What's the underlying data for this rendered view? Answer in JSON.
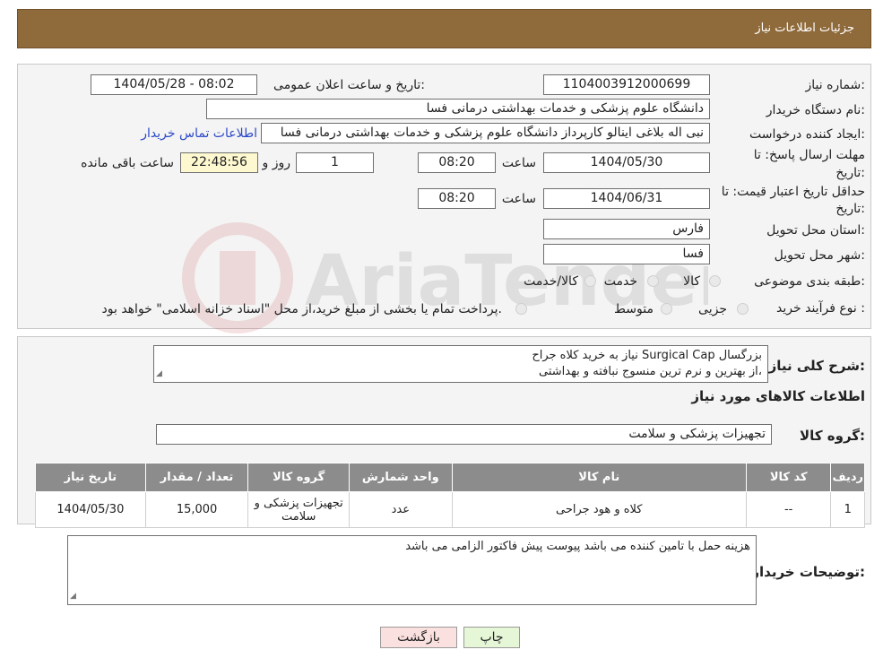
{
  "header": {
    "title": "جزئیات اطلاعات نیاز"
  },
  "need_number": {
    "label": "شماره نیاز:",
    "value": "1104003912000699"
  },
  "announce_datetime": {
    "label": "تاریخ و ساعت اعلان عمومی:",
    "value": "1404/05/28 - 08:02"
  },
  "buyer_org": {
    "label": "نام دستگاه خریدار:",
    "value": "دانشگاه علوم پزشکی و خدمات بهداشتی درمانی فسا"
  },
  "requester": {
    "label": "ایجاد کننده درخواست:",
    "value": "نبی اله بلاغی اینالو کارپرداز دانشگاه علوم پزشکی و خدمات بهداشتی درمانی فسا",
    "contact_link": "اطلاعات تماس خریدار"
  },
  "reply_deadline": {
    "label_line1": "مهلت ارسال پاسخ: تا",
    "label_line2": "تاریخ:",
    "date": "1404/05/30",
    "time_label": "ساعت",
    "time": "08:20",
    "days": "1",
    "days_label": "روز و",
    "remaining": "22:48:56",
    "remaining_label": "ساعت باقی مانده"
  },
  "price_validity": {
    "label_line1": "حداقل تاریخ اعتبار قیمت: تا",
    "label_line2": "تاریخ:",
    "date": "1404/06/31",
    "time_label": "ساعت",
    "time": "08:20"
  },
  "province": {
    "label": "استان محل تحویل:",
    "value": "فارس"
  },
  "city": {
    "label": "شهر محل تحویل:",
    "value": "فسا"
  },
  "category": {
    "label": "طبقه بندی موضوعی:",
    "options": [
      "کالا",
      "خدمت",
      "کالا/خدمت"
    ]
  },
  "purchase_process": {
    "label": "نوع فرآیند خرید :",
    "options": [
      "جزیی",
      "متوسط"
    ],
    "note": "پرداخت تمام یا بخشی از مبلغ خرید،از محل \"اسناد خزانه اسلامی\" خواهد بود."
  },
  "description": {
    "label": "شرح کلی نیاز:",
    "line1": "نیاز به خرید کلاه جراح Surgical Cap بزرگسال",
    "line2": "از بهترین و نرم ترین منسوج نبافته و بهداشتی،"
  },
  "goods_info_title": "اطلاعات کالاهای مورد نیاز",
  "goods_group": {
    "label": "گروه کالا:",
    "value": "تجهیزات پزشکی و سلامت"
  },
  "table": {
    "headers": [
      "ردیف",
      "کد کالا",
      "نام کالا",
      "واحد شمارش",
      "گروه کالا",
      "تعداد / مقدار",
      "تاریخ نیاز"
    ],
    "rows": [
      [
        "1",
        "--",
        "کلاه و هود جراحی",
        "عدد",
        "تجهیزات پزشکی و سلامت",
        "15,000",
        "1404/05/30"
      ]
    ]
  },
  "buyer_notes": {
    "label": "توضیحات خریدار:",
    "value": "هزینه حمل با تامین کننده می باشد پیوست پیش فاکتور الزامی می باشد"
  },
  "buttons": {
    "print": "چاپ",
    "back": "بازگشت"
  },
  "watermark": {
    "text": "AriaTender.neT"
  },
  "colors": {
    "header_bg": "#8f6a3b",
    "link": "#2b48c8",
    "table_header": "#8c8c8c",
    "back_button": "#fbe0e0",
    "print_button": "#e6f7d8"
  }
}
